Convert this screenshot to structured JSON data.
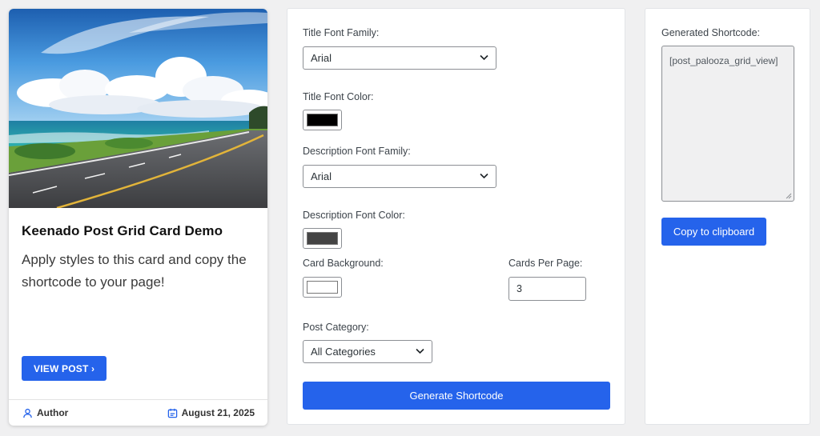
{
  "preview_card": {
    "image_alt": "Coastal road beside the ocean under blue sky",
    "title": "Keenado Post Grid Card Demo",
    "description": "Apply styles to this card and copy the shortcode to your page!",
    "button_label": "VIEW POST ›",
    "author_label": "Author",
    "date": "August 21, 2025",
    "icons": {
      "author": "user-icon",
      "date": "calendar-icon"
    }
  },
  "settings": {
    "title_font_family": {
      "label": "Title Font Family:",
      "value": "Arial"
    },
    "title_font_color": {
      "label": "Title Font Color:",
      "value": "#000000"
    },
    "description_font_family": {
      "label": "Description Font Family:",
      "value": "Arial"
    },
    "description_font_color": {
      "label": "Description Font Color:",
      "value": "#444444"
    },
    "card_background": {
      "label": "Card Background:",
      "value": "#ffffff"
    },
    "cards_per_page": {
      "label": "Cards Per Page:",
      "value": "3"
    },
    "post_category": {
      "label": "Post Category:",
      "value": "All Categories"
    },
    "generate_label": "Generate Shortcode"
  },
  "shortcode": {
    "label": "Generated Shortcode:",
    "value": "[post_palooza_grid_view]",
    "copy_label": "Copy to clipboard"
  },
  "colors": {
    "accent": "#2563eb",
    "page_bg": "#f0f0f1"
  }
}
